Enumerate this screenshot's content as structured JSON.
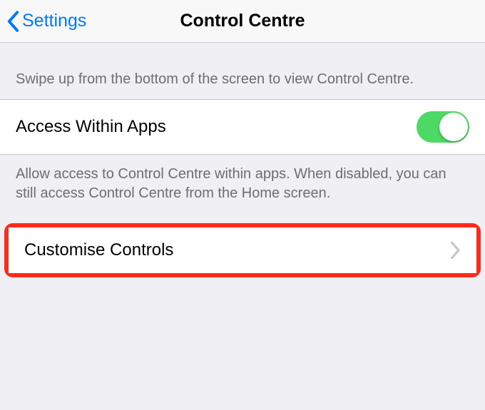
{
  "nav": {
    "back_label": "Settings",
    "title": "Control Centre"
  },
  "section1": {
    "description": "Swipe up from the bottom of the screen to view Control Centre."
  },
  "access_row": {
    "label": "Access Within Apps",
    "toggle_on": true
  },
  "section1_footer": "Allow access to Control Centre within apps. When disabled, you can still access Control Centre from the Home screen.",
  "customise_row": {
    "label": "Customise Controls"
  }
}
